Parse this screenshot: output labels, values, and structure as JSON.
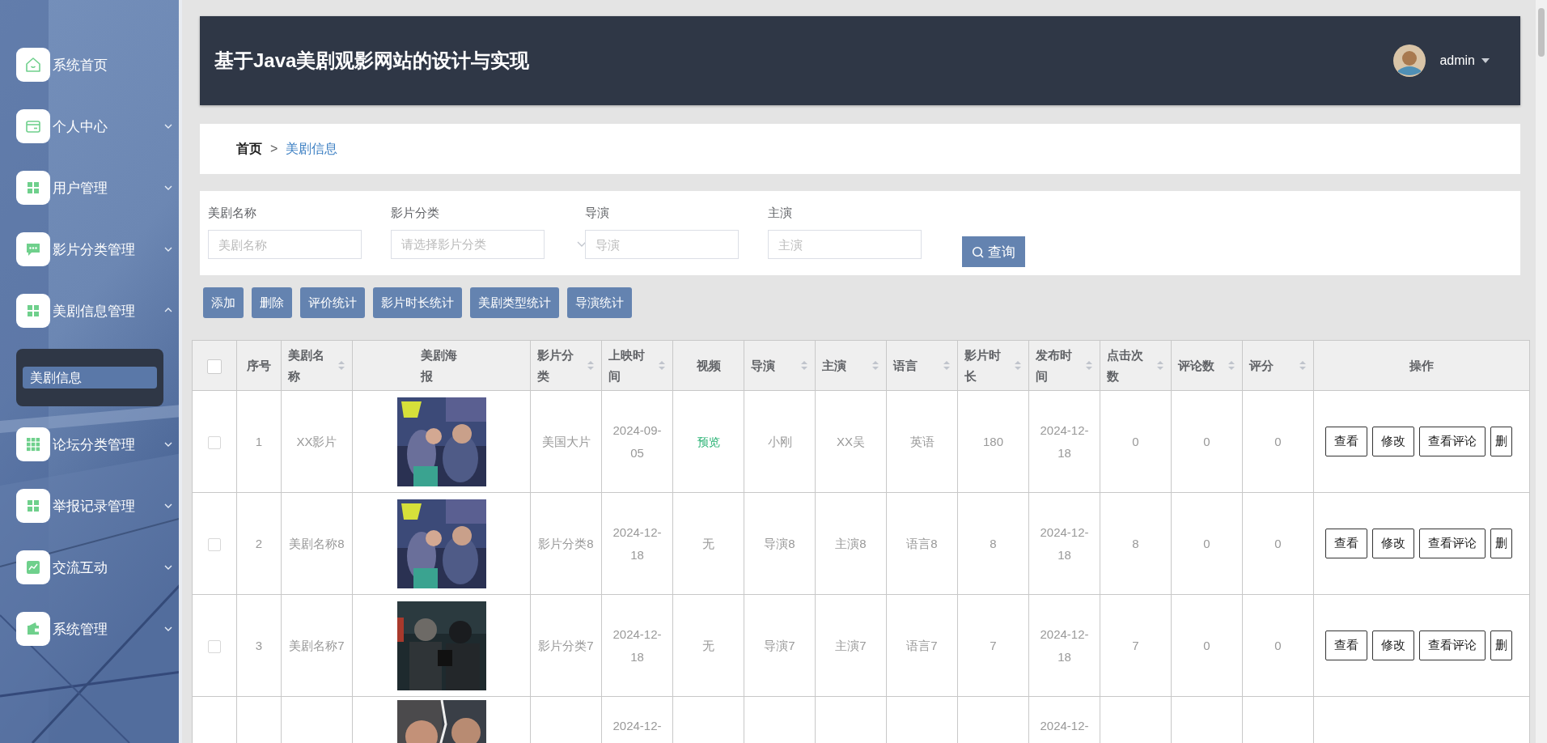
{
  "sidebar": {
    "items": [
      {
        "label": "系统首页",
        "kind": "link"
      },
      {
        "label": "个人中心",
        "kind": "group",
        "expanded": false
      },
      {
        "label": "用户管理",
        "kind": "group",
        "expanded": false
      },
      {
        "label": "影片分类管理",
        "kind": "group",
        "expanded": false
      },
      {
        "label": "美剧信息管理",
        "kind": "group",
        "expanded": true,
        "children": [
          {
            "label": "美剧信息",
            "selected": true
          }
        ]
      },
      {
        "label": "论坛分类管理",
        "kind": "group",
        "expanded": false
      },
      {
        "label": "举报记录管理",
        "kind": "group",
        "expanded": false
      },
      {
        "label": "交流互动",
        "kind": "group",
        "expanded": false
      },
      {
        "label": "系统管理",
        "kind": "group",
        "expanded": false
      }
    ]
  },
  "header": {
    "title": "基于Java美剧观影网站的设计与实现",
    "user": "admin"
  },
  "breadcrumb": {
    "separator": ">",
    "items": [
      {
        "label": "首页",
        "current": false
      },
      {
        "label": "美剧信息",
        "current": true
      }
    ]
  },
  "search": {
    "fields": [
      {
        "label": "美剧名称",
        "placeholder": "美剧名称",
        "kind": "input"
      },
      {
        "label": "影片分类",
        "placeholder": "请选择影片分类",
        "kind": "select"
      },
      {
        "label": "导演",
        "placeholder": "导演",
        "kind": "input"
      },
      {
        "label": "主演",
        "placeholder": "主演",
        "kind": "input"
      }
    ],
    "button": "查询"
  },
  "toolbar": [
    "添加",
    "删除",
    "评价统计",
    "影片时长统计",
    "美剧类型统计",
    "导演统计"
  ],
  "table": {
    "select_all_checked": false,
    "columns": [
      {
        "label": "序号",
        "sortable": false
      },
      {
        "label": "美剧名称",
        "sortable": true
      },
      {
        "label": "美剧海报",
        "sortable": false
      },
      {
        "label": "影片分类",
        "sortable": true
      },
      {
        "label": "上映时间",
        "sortable": true
      },
      {
        "label": "视频",
        "sortable": false
      },
      {
        "label": "导演",
        "sortable": true
      },
      {
        "label": "主演",
        "sortable": true
      },
      {
        "label": "语言",
        "sortable": true
      },
      {
        "label": "影片时长",
        "sortable": true
      },
      {
        "label": "发布时间",
        "sortable": true
      },
      {
        "label": "点击次数",
        "sortable": true
      },
      {
        "label": "评论数",
        "sortable": true
      },
      {
        "label": "评分",
        "sortable": true
      },
      {
        "label": "操作",
        "sortable": false
      }
    ],
    "rows": [
      {
        "checked": false,
        "cells": [
          {
            "kind": "text",
            "text": "1"
          },
          {
            "kind": "text",
            "text": "XX影片"
          },
          {
            "kind": "picture"
          },
          {
            "kind": "text",
            "text": "美国大片"
          },
          {
            "kind": "text",
            "text": "2024-09-05"
          },
          {
            "kind": "link",
            "text": "预览"
          },
          {
            "kind": "text",
            "text": "小刚"
          },
          {
            "kind": "text",
            "text": "XX吴"
          },
          {
            "kind": "text",
            "text": "英语"
          },
          {
            "kind": "text",
            "text": "180"
          },
          {
            "kind": "text",
            "text": "2024-12-18"
          },
          {
            "kind": "text",
            "text": "0"
          },
          {
            "kind": "text",
            "text": "0"
          },
          {
            "kind": "text",
            "text": "0"
          },
          {
            "kind": "actions",
            "buttons": [
              "查看",
              "修改",
              "查看评论",
              "删"
            ]
          }
        ]
      },
      {
        "checked": false,
        "cells": [
          {
            "kind": "text",
            "text": "2"
          },
          {
            "kind": "text",
            "text": "美剧名称8"
          },
          {
            "kind": "picture"
          },
          {
            "kind": "text",
            "text": "影片分类8"
          },
          {
            "kind": "text",
            "text": "2024-12-18"
          },
          {
            "kind": "text",
            "text": "无"
          },
          {
            "kind": "text",
            "text": "导演8"
          },
          {
            "kind": "text",
            "text": "主演8"
          },
          {
            "kind": "text",
            "text": "语言8"
          },
          {
            "kind": "text",
            "text": "8"
          },
          {
            "kind": "text",
            "text": "2024-12-18"
          },
          {
            "kind": "text",
            "text": "8"
          },
          {
            "kind": "text",
            "text": "0"
          },
          {
            "kind": "text",
            "text": "0"
          },
          {
            "kind": "actions",
            "buttons": [
              "查看",
              "修改",
              "查看评论",
              "删"
            ]
          }
        ]
      },
      {
        "checked": false,
        "cells": [
          {
            "kind": "text",
            "text": "3"
          },
          {
            "kind": "text",
            "text": "美剧名称7"
          },
          {
            "kind": "picture"
          },
          {
            "kind": "text",
            "text": "影片分类7"
          },
          {
            "kind": "text",
            "text": "2024-12-18"
          },
          {
            "kind": "text",
            "text": "无"
          },
          {
            "kind": "text",
            "text": "导演7"
          },
          {
            "kind": "text",
            "text": "主演7"
          },
          {
            "kind": "text",
            "text": "语言7"
          },
          {
            "kind": "text",
            "text": "7"
          },
          {
            "kind": "text",
            "text": "2024-12-18"
          },
          {
            "kind": "text",
            "text": "7"
          },
          {
            "kind": "text",
            "text": "0"
          },
          {
            "kind": "text",
            "text": "0"
          },
          {
            "kind": "actions",
            "buttons": [
              "查看",
              "修改",
              "查看评论",
              "删"
            ]
          }
        ]
      },
      {
        "cells": [
          null,
          null,
          {
            "kind": "picture"
          },
          null,
          {
            "kind": "text",
            "text": "2024-12-"
          },
          null,
          null,
          null,
          null,
          null,
          {
            "kind": "text",
            "text": "2024-12-"
          },
          null,
          null,
          null,
          null
        ]
      }
    ]
  }
}
